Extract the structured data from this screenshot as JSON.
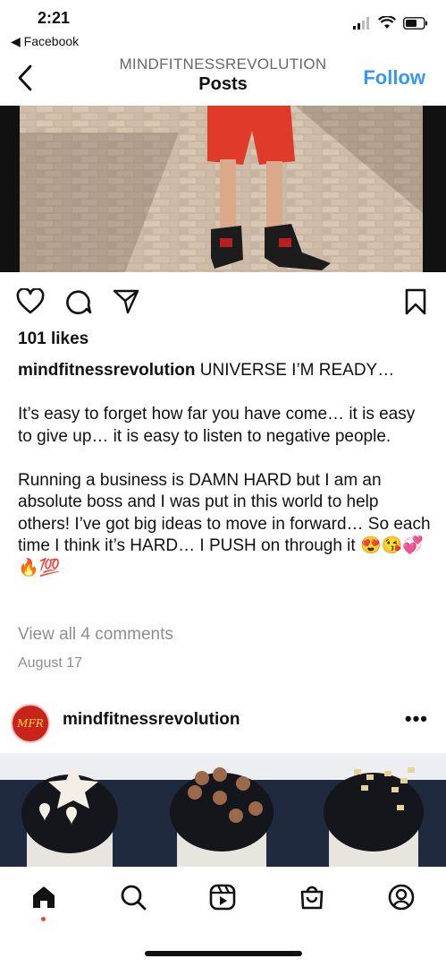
{
  "status_bar": {
    "time": "2:21",
    "back_app": "◀ Facebook"
  },
  "header": {
    "username": "MINDFITNESSREVOLUTION",
    "title": "Posts",
    "follow_label": "Follow"
  },
  "post": {
    "likes": "101 likes",
    "caption_user": "mindfitnessrevolution",
    "caption_first": "UNIVERSE I’M READY…",
    "caption_p2": "It’s easy to forget how far you have come… it is easy to give up… it is easy to listen to negative people.",
    "caption_p3": "Running a business is DAMN HARD but I am an absolute boss and I was put in this world to help others! I’ve got big ideas to move in forward… So each time I think it’s HARD… I PUSH on through it",
    "caption_emojis": "😍😘💞🔥💯",
    "view_comments": "View all 4 comments",
    "date": "August 17"
  },
  "next_post": {
    "username": "mindfitnessrevolution",
    "avatar_text": "MFR"
  },
  "icons": {
    "like": "heart-icon",
    "comment": "comment-icon",
    "share": "send-icon",
    "save": "bookmark-icon",
    "nav": [
      "home-icon",
      "search-icon",
      "reels-icon",
      "shop-icon",
      "profile-icon"
    ]
  },
  "colors": {
    "follow": "#3897f0",
    "meta_gray": "#8e8e8e",
    "avatar": "#c8241c"
  }
}
